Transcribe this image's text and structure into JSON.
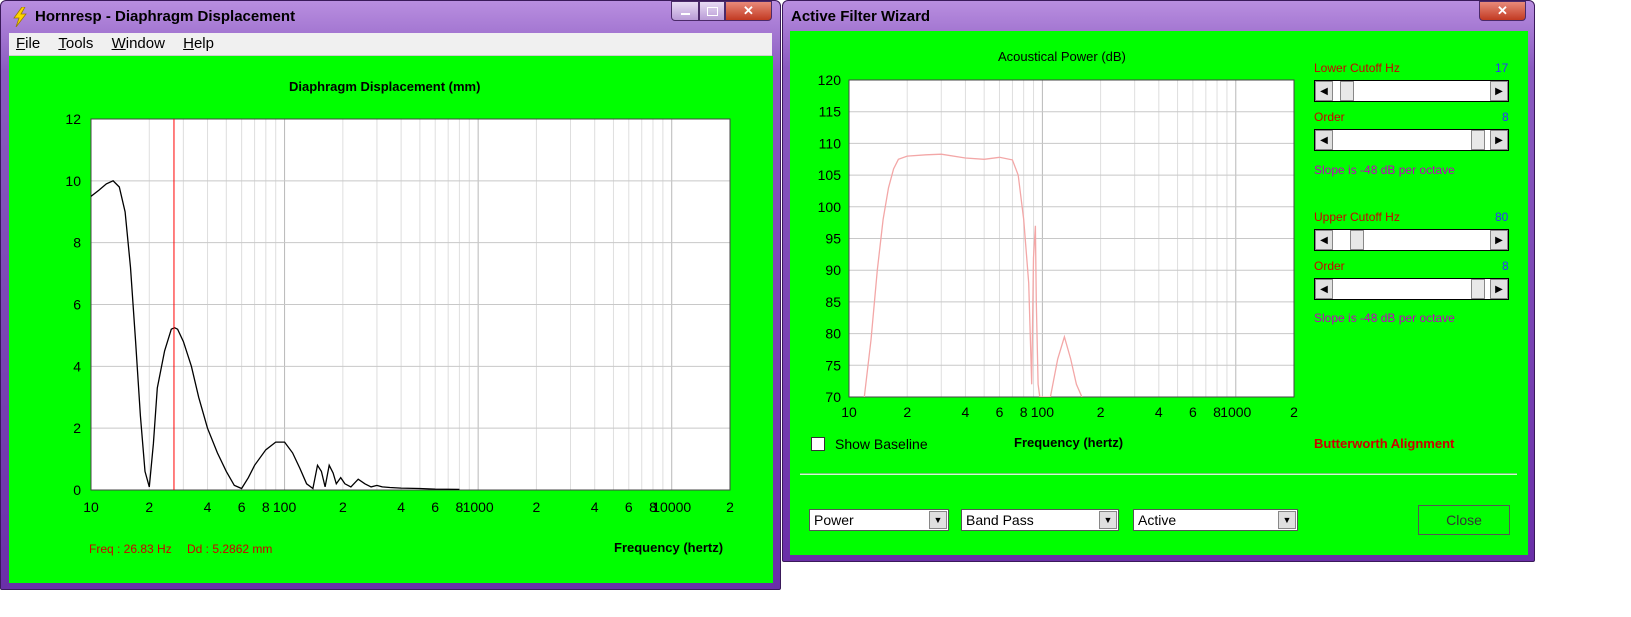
{
  "left_window": {
    "title": "Hornresp - Diaphragm Displacement",
    "menu": [
      "File",
      "Tools",
      "Window",
      "Help"
    ],
    "menu_underline": [
      "F",
      "T",
      "W",
      "H"
    ],
    "readout_freq": "Freq : 26.83 Hz",
    "readout_dd": "Dd : 5.2862 mm",
    "chart": {
      "title": "Diaphragm Displacement (mm)",
      "xlabel": "Frequency (hertz)",
      "y_ticks": [
        "12",
        "10",
        "8",
        "6",
        "4",
        "2",
        "0"
      ],
      "x_ticks": [
        "10",
        "2",
        "4",
        "6",
        "8",
        "100",
        "2",
        "4",
        "6",
        "8",
        "1000",
        "2",
        "4",
        "6",
        "8",
        "10000",
        "2"
      ]
    }
  },
  "right_window": {
    "title": "Active Filter Wizard",
    "chart": {
      "title": "Acoustical Power (dB)",
      "xlabel": "Frequency (hertz)",
      "y_ticks": [
        "120",
        "115",
        "110",
        "105",
        "100",
        "95",
        "90",
        "85",
        "80",
        "75",
        "70"
      ],
      "x_ticks": [
        "10",
        "2",
        "4",
        "6",
        "8",
        "100",
        "2",
        "4",
        "6",
        "8",
        "1000",
        "2"
      ]
    },
    "lower_cutoff_label": "Lower Cutoff  Hz",
    "lower_cutoff_value": "17",
    "lower_order_label": "Order",
    "lower_order_value": "8",
    "lower_slope": "Slope is -48 dB per octave",
    "upper_cutoff_label": "Upper Cutoff  Hz",
    "upper_cutoff_value": "80",
    "upper_order_label": "Order",
    "upper_order_value": "8",
    "upper_slope": "Slope is -48 dB per octave",
    "alignment": "Butterworth Alignment",
    "show_baseline": "Show Baseline",
    "combo_1": "Power",
    "combo_2": "Band Pass",
    "combo_3": "Active",
    "close_button": "Close"
  },
  "chart_data": [
    {
      "type": "line",
      "title": "Diaphragm Displacement (mm)",
      "xlabel": "Frequency (hertz)",
      "ylabel": "",
      "x_scale": "log",
      "xlim": [
        10,
        20000
      ],
      "ylim": [
        0,
        12
      ],
      "grid": true,
      "marker_x": 26.83,
      "series": [
        {
          "x": [
            10,
            11,
            12,
            13,
            14,
            15,
            16,
            17,
            18,
            19,
            20,
            21,
            22,
            24,
            26,
            27,
            28,
            30,
            33,
            36,
            40,
            45,
            50,
            55,
            60,
            65,
            70,
            80,
            90,
            100,
            110,
            120,
            130,
            140,
            148,
            155,
            162,
            170,
            178,
            185,
            195,
            205,
            220,
            240,
            260,
            280,
            300,
            320,
            350,
            400,
            500,
            600,
            800
          ],
          "y": [
            9.5,
            9.7,
            9.9,
            10.0,
            9.8,
            9.0,
            7.2,
            4.8,
            2.4,
            0.6,
            0.1,
            1.5,
            3.3,
            4.5,
            5.2,
            5.25,
            5.2,
            4.8,
            4.0,
            3.0,
            2.0,
            1.2,
            0.6,
            0.15,
            0.05,
            0.4,
            0.8,
            1.3,
            1.55,
            1.55,
            1.2,
            0.7,
            0.2,
            0.05,
            0.8,
            0.6,
            0.1,
            0.8,
            0.55,
            0.2,
            0.4,
            0.2,
            0.1,
            0.35,
            0.2,
            0.1,
            0.15,
            0.1,
            0.08,
            0.06,
            0.05,
            0.03,
            0.02
          ]
        }
      ]
    },
    {
      "type": "line",
      "title": "Acoustical Power (dB)",
      "xlabel": "Frequency (hertz)",
      "ylabel": "",
      "x_scale": "log",
      "xlim": [
        10,
        2000
      ],
      "ylim": [
        70,
        120
      ],
      "grid": true,
      "series": [
        {
          "x": [
            12,
            13,
            14,
            15,
            16,
            17,
            18,
            20,
            25,
            30,
            40,
            50,
            60,
            70,
            75,
            80,
            85,
            88,
            90,
            92,
            93,
            95,
            97,
            100,
            103,
            110,
            120,
            130,
            140,
            150,
            160
          ],
          "y": [
            70,
            79,
            90,
            98,
            103,
            106,
            107.5,
            108,
            108.2,
            108.3,
            107.7,
            107.5,
            107.8,
            107.4,
            105,
            98,
            88,
            72,
            92,
            97,
            85,
            72,
            70,
            70,
            70,
            70,
            76,
            79.5,
            76,
            72,
            70
          ]
        }
      ]
    }
  ]
}
